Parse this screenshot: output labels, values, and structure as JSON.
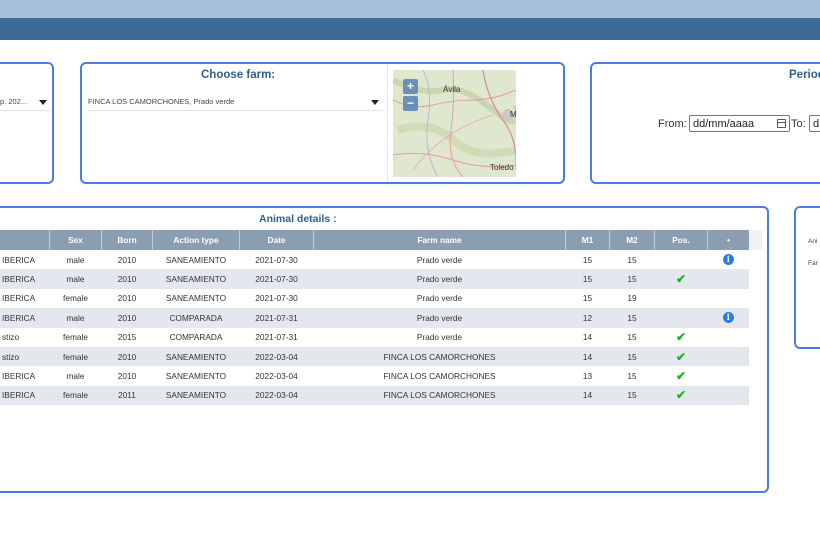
{
  "left_panel": {
    "select_value": "p. 202..."
  },
  "farm_panel": {
    "title": "Choose farm:",
    "selected": "FINCA LOS CAMORCHONES,  Prado verde",
    "map": {
      "zoom_in": "+",
      "zoom_out": "−",
      "labels": [
        "Ávila",
        "Toledo",
        "M"
      ]
    }
  },
  "period_panel": {
    "title": "Period",
    "from_label": "From:",
    "from_placeholder": "dd/mm/aaaa",
    "to_label": "To:",
    "to_placeholder": "d"
  },
  "animal_details": {
    "title": "Animal details :",
    "columns": [
      "",
      "Sex",
      "Born",
      "Action type",
      "Date",
      "Farm name",
      "M1",
      "M2",
      "Pos.",
      "•"
    ],
    "rows": [
      {
        "breed": "IBERICA",
        "sex": "male",
        "born": "2010",
        "action": "SANEAMIENTO",
        "date": "2021-07-30",
        "farm": "Prado verde",
        "m1": "15",
        "m2": "15",
        "pos": false,
        "info": true
      },
      {
        "breed": "IBERICA",
        "sex": "male",
        "born": "2010",
        "action": "SANEAMIENTO",
        "date": "2021-07-30",
        "farm": "Prado verde",
        "m1": "15",
        "m2": "15",
        "pos": true,
        "info": false
      },
      {
        "breed": "IBERICA",
        "sex": "female",
        "born": "2010",
        "action": "SANEAMIENTO",
        "date": "2021-07-30",
        "farm": "Prado verde",
        "m1": "15",
        "m2": "19",
        "pos": false,
        "info": false
      },
      {
        "breed": "IBERICA",
        "sex": "male",
        "born": "2010",
        "action": "COMPARADA",
        "date": "2021-07-31",
        "farm": "Prado verde",
        "m1": "12",
        "m2": "15",
        "pos": false,
        "info": true
      },
      {
        "breed": "stizo",
        "sex": "female",
        "born": "2015",
        "action": "COMPARADA",
        "date": "2021-07-31",
        "farm": "Prado verde",
        "m1": "14",
        "m2": "15",
        "pos": true,
        "info": false
      },
      {
        "breed": "stizo",
        "sex": "female",
        "born": "2010",
        "action": "SANEAMIENTO",
        "date": "2022-03-04",
        "farm": "FINCA LOS CAMORCHONES",
        "m1": "14",
        "m2": "15",
        "pos": true,
        "info": false
      },
      {
        "breed": "IBERICA",
        "sex": "male",
        "born": "2010",
        "action": "SANEAMIENTO",
        "date": "2022-03-04",
        "farm": "FINCA LOS CAMORCHONES",
        "m1": "13",
        "m2": "15",
        "pos": true,
        "info": false
      },
      {
        "breed": "IBERICA",
        "sex": "female",
        "born": "2011",
        "action": "SANEAMIENTO",
        "date": "2022-03-04",
        "farm": "FINCA LOS CAMORCHONES",
        "m1": "14",
        "m2": "15",
        "pos": true,
        "info": false
      }
    ],
    "check_symbol": "✔",
    "info_symbol": "i"
  },
  "right_panel": {
    "line1": "Ani",
    "line2": "Far"
  },
  "colors": {
    "header_dark": "#3c6a92",
    "header_light": "#a7c1db",
    "panel_border": "#4a7de0",
    "table_header": "#8b9db0",
    "check": "#22b322",
    "info": "#2a7ee0"
  }
}
